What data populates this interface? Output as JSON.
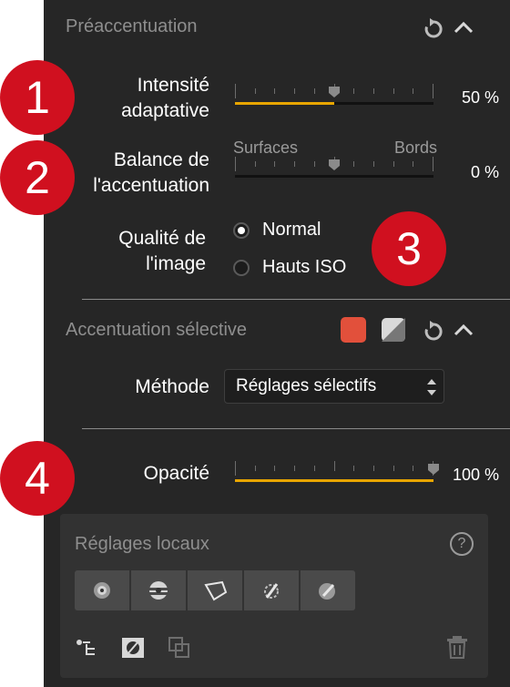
{
  "sharpening": {
    "title": "Préaccentuation",
    "intensity_label": "Intensité adaptative",
    "intensity_value": "50 %",
    "intensity_percent": 50,
    "balance_label": "Balance de l'accentuation",
    "balance_left": "Surfaces",
    "balance_right": "Bords",
    "balance_value": "0 %",
    "balance_percent": 0,
    "quality_label": "Qualité de l'image",
    "quality_options": [
      "Normal",
      "Hauts ISO"
    ],
    "quality_selected": "Normal"
  },
  "selective": {
    "title": "Accentuation sélective",
    "method_label": "Méthode",
    "method_value": "Réglages sélectifs",
    "color_swatch": "#e2503b"
  },
  "opacity": {
    "label": "Opacité",
    "value": "100 %",
    "percent": 100
  },
  "local": {
    "title": "Réglages locaux",
    "help": "?",
    "tools": [
      "control-point-icon",
      "graduated-filter-icon",
      "polygon-mask-icon",
      "auto-mask-brush-icon",
      "eyedropper-icon"
    ],
    "bottom_icons": [
      "hierarchy-list-icon",
      "mask-toggle-icon",
      "duplicate-icon",
      "trash-icon"
    ]
  },
  "badges": [
    "1",
    "2",
    "3",
    "4"
  ],
  "colors": {
    "panel": "#262626",
    "accent": "#e8a500",
    "badge": "#d0101f"
  }
}
